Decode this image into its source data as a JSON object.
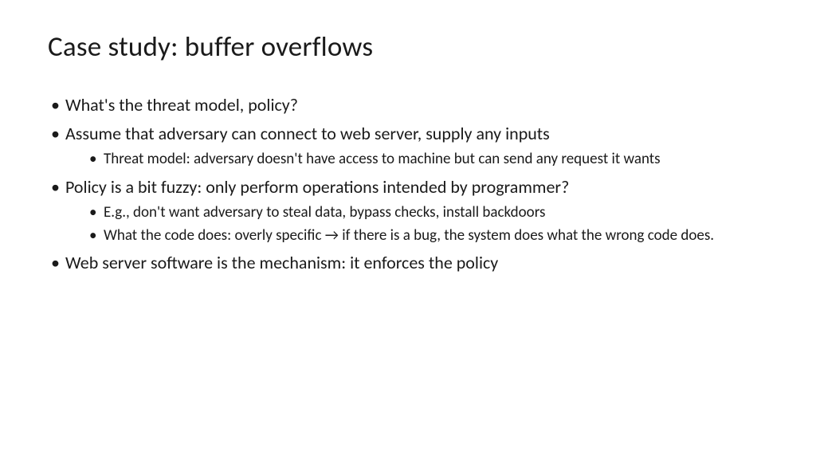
{
  "title": "Case study: buffer overflows",
  "bullets": [
    {
      "text": "What's the threat model, policy?",
      "sub": []
    },
    {
      "text": "Assume that adversary can connect to web server, supply any inputs",
      "sub": [
        "Threat model: adversary doesn't have access to machine but can send any request it wants"
      ]
    },
    {
      "text": "Policy is a bit fuzzy: only perform operations intended by programmer?",
      "sub": [
        "E.g., don't want adversary to steal data, bypass checks, install backdoors",
        "What the code does: overly specific → if there is a bug, the system does what the wrong code does."
      ]
    },
    {
      "text": "Web server software is the mechanism: it enforces the policy",
      "sub": []
    }
  ]
}
